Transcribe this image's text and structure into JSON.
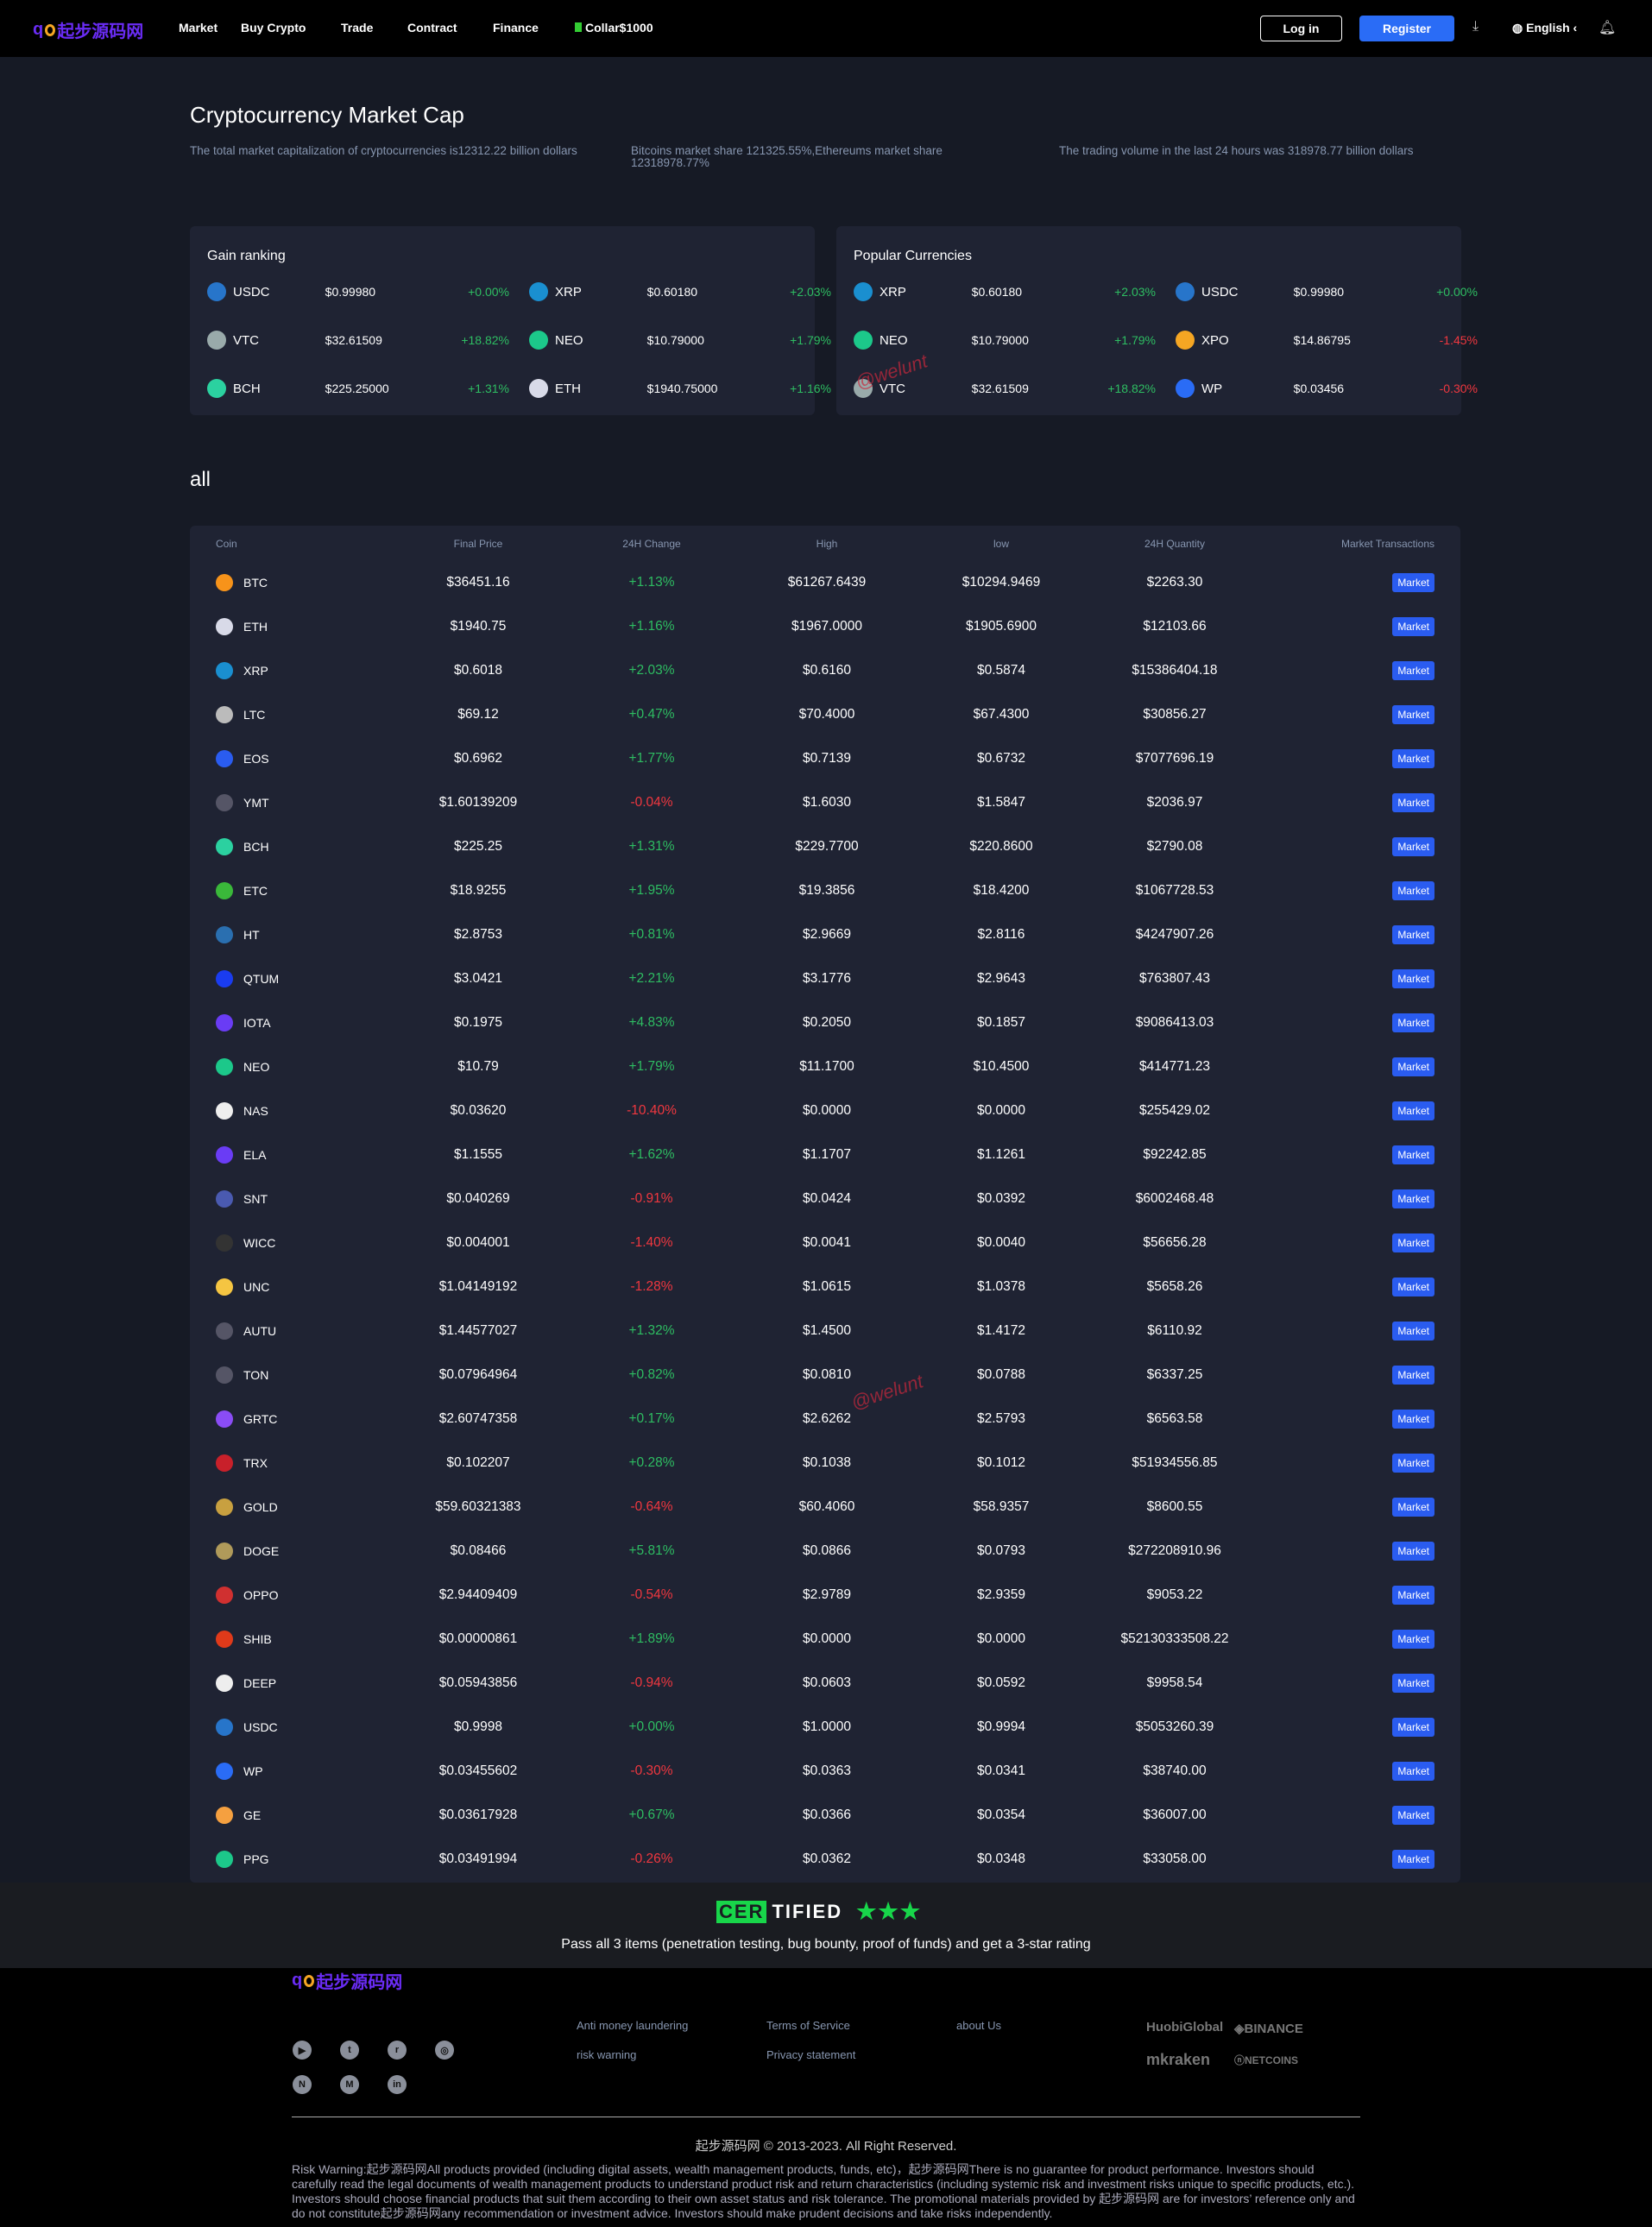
{
  "header": {
    "logo": "起步源码网",
    "nav": [
      "Market",
      "Buy Crypto",
      "Trade",
      "Contract",
      "Finance"
    ],
    "collar": "Collar$1000",
    "login": "Log in",
    "register": "Register",
    "language": "English"
  },
  "hero": {
    "title": "Cryptocurrency Market Cap",
    "stats": [
      "The total market capitalization of cryptocurrencies is12312.22 billion dollars",
      "Bitcoins market share 121325.55%,Ethereums market share 12318978.77%",
      "The trading volume in the last 24 hours was 318978.77 billion dollars"
    ]
  },
  "gain": {
    "title": "Gain ranking",
    "items": [
      {
        "sym": "USDC",
        "price": "$0.99980",
        "change": "+0.00%",
        "color": "#2775ca"
      },
      {
        "sym": "XRP",
        "price": "$0.60180",
        "change": "+2.03%",
        "color": "#1a8fd0"
      },
      {
        "sym": "VTC",
        "price": "$32.61509",
        "change": "+18.82%",
        "color": "#9aa"
      },
      {
        "sym": "NEO",
        "price": "$10.79000",
        "change": "+1.79%",
        "color": "#1cc88a"
      },
      {
        "sym": "BCH",
        "price": "$225.25000",
        "change": "+1.31%",
        "color": "#2bd1a0"
      },
      {
        "sym": "ETH",
        "price": "$1940.75000",
        "change": "+1.16%",
        "color": "#d8dae8"
      }
    ]
  },
  "popular": {
    "title": "Popular Currencies",
    "items": [
      {
        "sym": "XRP",
        "price": "$0.60180",
        "change": "+2.03%",
        "color": "#1a8fd0"
      },
      {
        "sym": "USDC",
        "price": "$0.99980",
        "change": "+0.00%",
        "color": "#2775ca"
      },
      {
        "sym": "NEO",
        "price": "$10.79000",
        "change": "+1.79%",
        "color": "#1cc88a"
      },
      {
        "sym": "XPO",
        "price": "$14.86795",
        "change": "-1.45%",
        "color": "#f5a623"
      },
      {
        "sym": "VTC",
        "price": "$32.61509",
        "change": "+18.82%",
        "color": "#9aa"
      },
      {
        "sym": "WP",
        "price": "$0.03456",
        "change": "-0.30%",
        "color": "#2a6cf6"
      }
    ]
  },
  "table": {
    "section_title": "all",
    "headers": [
      "Coin",
      "Final Price",
      "24H Change",
      "High",
      "low",
      "24H Quantity",
      "Market Transactions"
    ],
    "action_label": "Market",
    "rows": [
      [
        "BTC",
        "$36451.16",
        "+1.13%",
        "$61267.6439",
        "$10294.9469",
        "$2263.30",
        "#f7931a"
      ],
      [
        "ETH",
        "$1940.75",
        "+1.16%",
        "$1967.0000",
        "$1905.6900",
        "$12103.66",
        "#d8dae8"
      ],
      [
        "XRP",
        "$0.6018",
        "+2.03%",
        "$0.6160",
        "$0.5874",
        "$15386404.18",
        "#1a8fd0"
      ],
      [
        "LTC",
        "$69.12",
        "+0.47%",
        "$70.4000",
        "$67.4300",
        "$30856.27",
        "#bbb"
      ],
      [
        "EOS",
        "$0.6962",
        "+1.77%",
        "$0.7139",
        "$0.6732",
        "$7077696.19",
        "#2a5cf0"
      ],
      [
        "YMT",
        "$1.60139209",
        "-0.04%",
        "$1.6030",
        "$1.5847",
        "$2036.97",
        "#556"
      ],
      [
        "BCH",
        "$225.25",
        "+1.31%",
        "$229.7700",
        "$220.8600",
        "$2790.08",
        "#2bd1a0"
      ],
      [
        "ETC",
        "$18.9255",
        "+1.95%",
        "$19.3856",
        "$18.4200",
        "$1067728.53",
        "#3ab83a"
      ],
      [
        "HT",
        "$2.8753",
        "+0.81%",
        "$2.9669",
        "$2.8116",
        "$4247907.26",
        "#2a6fb0"
      ],
      [
        "QTUM",
        "$3.0421",
        "+2.21%",
        "$3.1776",
        "$2.9643",
        "$763807.43",
        "#1a3cf0"
      ],
      [
        "IOTA",
        "$0.1975",
        "+4.83%",
        "$0.2050",
        "$0.1857",
        "$9086413.03",
        "#6a3cf5"
      ],
      [
        "NEO",
        "$10.79",
        "+1.79%",
        "$11.1700",
        "$10.4500",
        "$414771.23",
        "#1cc88a"
      ],
      [
        "NAS",
        "$0.03620",
        "-10.40%",
        "$0.0000",
        "$0.0000",
        "$255429.02",
        "#eee"
      ],
      [
        "ELA",
        "$1.1555",
        "+1.62%",
        "$1.1707",
        "$1.1261",
        "$92242.85",
        "#6a3cf5"
      ],
      [
        "SNT",
        "$0.040269",
        "-0.91%",
        "$0.0424",
        "$0.0392",
        "$6002468.48",
        "#4a5ab0"
      ],
      [
        "WICC",
        "$0.004001",
        "-1.40%",
        "$0.0041",
        "$0.0040",
        "$56656.28",
        "#333"
      ],
      [
        "UNC",
        "$1.04149192",
        "-1.28%",
        "$1.0615",
        "$1.0378",
        "$5658.26",
        "#f5c542"
      ],
      [
        "AUTU",
        "$1.44577027",
        "+1.32%",
        "$1.4500",
        "$1.4172",
        "$6110.92",
        "#556"
      ],
      [
        "TON",
        "$0.07964964",
        "+0.82%",
        "$0.0810",
        "$0.0788",
        "$6337.25",
        "#556"
      ],
      [
        "GRTC",
        "$2.60747358",
        "+0.17%",
        "$2.6262",
        "$2.5793",
        "$6563.58",
        "#8a4cf5"
      ],
      [
        "TRX",
        "$0.102207",
        "+0.28%",
        "$0.1038",
        "$0.1012",
        "$51934556.85",
        "#c8202a"
      ],
      [
        "GOLD",
        "$59.60321383",
        "-0.64%",
        "$60.4060",
        "$58.9357",
        "$8600.55",
        "#c8a040"
      ],
      [
        "DOGE",
        "$0.08466",
        "+5.81%",
        "$0.0866",
        "$0.0793",
        "$272208910.96",
        "#b09a5a"
      ],
      [
        "OPPO",
        "$2.94409409",
        "-0.54%",
        "$2.9789",
        "$2.9359",
        "$9053.22",
        "#d03030"
      ],
      [
        "SHIB",
        "$0.00000861",
        "+1.89%",
        "$0.0000",
        "$0.0000",
        "$52130333508.22",
        "#e03a1a"
      ],
      [
        "DEEP",
        "$0.05943856",
        "-0.94%",
        "$0.0603",
        "$0.0592",
        "$9958.54",
        "#eee"
      ],
      [
        "USDC",
        "$0.9998",
        "+0.00%",
        "$1.0000",
        "$0.9994",
        "$5053260.39",
        "#2775ca"
      ],
      [
        "WP",
        "$0.03455602",
        "-0.30%",
        "$0.0363",
        "$0.0341",
        "$38740.00",
        "#2a6cf6"
      ],
      [
        "GE",
        "$0.03617928",
        "+0.67%",
        "$0.0366",
        "$0.0354",
        "$36007.00",
        "#f5a040"
      ],
      [
        "PPG",
        "$0.03491994",
        "-0.26%",
        "$0.0362",
        "$0.0348",
        "$33058.00",
        "#1cc88a"
      ]
    ]
  },
  "cert": {
    "logo_a": "CER",
    "logo_b": "TIFIED",
    "stars": "★★★",
    "text": "Pass all 3 items (penetration testing, bug bounty, proof of funds) and get a 3-star rating"
  },
  "footer": {
    "logo": "起步源码网",
    "links": [
      "Anti money laundering",
      "Terms of Service",
      "about Us",
      "risk warning",
      "Privacy statement"
    ],
    "socials": [
      "▶",
      "t",
      "r",
      "◎",
      "N",
      "M",
      "in"
    ],
    "partners": [
      "HuobiGlobal",
      "◈BINANCE",
      "mkraken",
      "ⓝNETCOINS"
    ],
    "copyright": "起步源码网 © 2013-2023. All Right Reserved.",
    "risk": "Risk Warning:起步源码网All products provided (including digital assets, wealth management products, funds, etc)，起步源码网There is no guarantee for product performance. Investors should carefully read the legal documents of wealth management products to understand product risk and return characteristics (including systemic risk and investment risks unique to specific products, etc.). Investors should choose financial products that suit them according to their own asset status and risk tolerance. The promotional materials provided by 起步源码网 are for investors’ reference only and do not constitute起步源码网any recommendation or investment advice. Investors should make prudent decisions and take risks independently."
  },
  "watermark": "@welunt"
}
